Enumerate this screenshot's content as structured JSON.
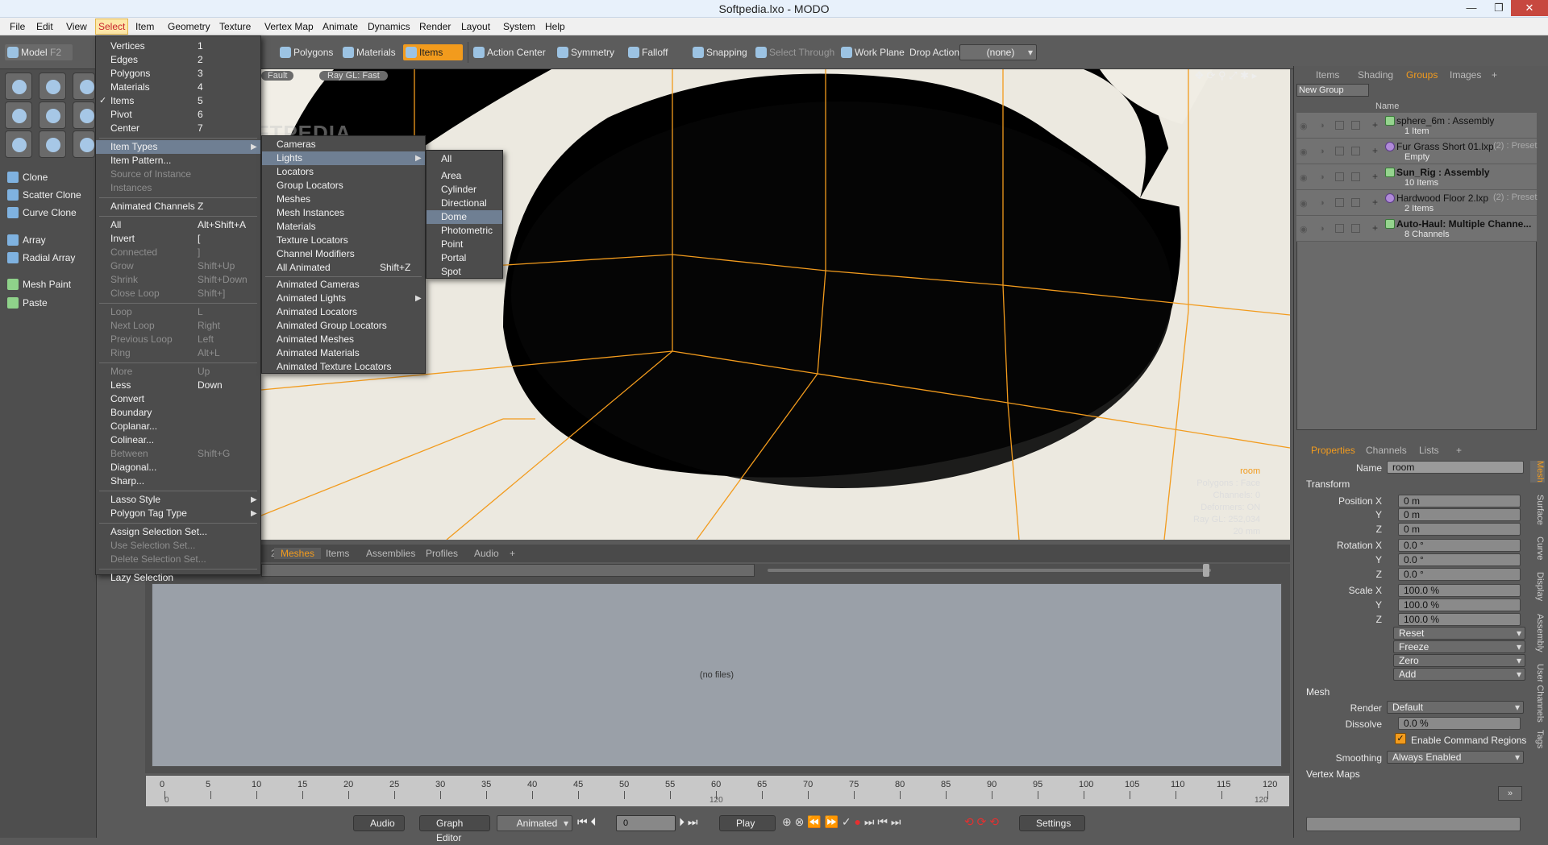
{
  "window": {
    "title": "Softpedia.lxo - MODO",
    "min": "—",
    "max": "❐",
    "close": "✕"
  },
  "menubar": [
    "File",
    "Edit",
    "View",
    "Select",
    "Item",
    "Geometry",
    "Texture",
    "Vertex Map",
    "Animate",
    "Dynamics",
    "Render",
    "Layout",
    "System",
    "Help"
  ],
  "toolbar": {
    "model": "Model",
    "model_key": "F2",
    "polygons": "Polygons",
    "materials": "Materials",
    "items": "Items",
    "action_center": "Action Center",
    "symmetry": "Symmetry",
    "falloff": "Falloff",
    "snapping": "Snapping",
    "select_through": "Select Through",
    "work_plane": "Work Plane",
    "drop_action": "Drop Action",
    "drop_value": "(none)"
  },
  "leftpanel": [
    "Clone",
    "Scatter Clone",
    "Curve Clone",
    "Array",
    "Radial Array",
    "Mesh Paint",
    "Paste"
  ],
  "select_menu": {
    "items": [
      {
        "label": "Vertices",
        "sc": "1"
      },
      {
        "label": "Edges",
        "sc": "2"
      },
      {
        "label": "Polygons",
        "sc": "3"
      },
      {
        "label": "Materials",
        "sc": "4"
      },
      {
        "label": "Items",
        "sc": "5"
      },
      {
        "label": "Pivot",
        "sc": "6"
      },
      {
        "label": "Center",
        "sc": "7"
      },
      {
        "label": "Item Types",
        "sc": ""
      },
      {
        "label": "Item Pattern...",
        "sc": ""
      },
      {
        "label": "Source of Instance",
        "sc": ""
      },
      {
        "label": "Instances",
        "sc": ""
      },
      {
        "label": "Animated Channels",
        "sc": "Z"
      },
      {
        "label": "All",
        "sc": "Alt+Shift+A"
      },
      {
        "label": "Invert",
        "sc": "["
      },
      {
        "label": "Connected",
        "sc": "]"
      },
      {
        "label": "Grow",
        "sc": "Shift+Up"
      },
      {
        "label": "Shrink",
        "sc": "Shift+Down"
      },
      {
        "label": "Close Loop",
        "sc": "Shift+]"
      },
      {
        "label": "Loop",
        "sc": "L"
      },
      {
        "label": "Next Loop",
        "sc": "Right"
      },
      {
        "label": "Previous Loop",
        "sc": "Left"
      },
      {
        "label": "Ring",
        "sc": "Alt+L"
      },
      {
        "label": "More",
        "sc": "Up"
      },
      {
        "label": "Less",
        "sc": "Down"
      },
      {
        "label": "Convert",
        "sc": ""
      },
      {
        "label": "Boundary",
        "sc": ""
      },
      {
        "label": "Coplanar...",
        "sc": ""
      },
      {
        "label": "Colinear...",
        "sc": ""
      },
      {
        "label": "Between",
        "sc": "Shift+G"
      },
      {
        "label": "Diagonal...",
        "sc": ""
      },
      {
        "label": "Sharp...",
        "sc": ""
      },
      {
        "label": "Lasso Style",
        "sc": ""
      },
      {
        "label": "Polygon Tag Type",
        "sc": ""
      },
      {
        "label": "Assign Selection Set...",
        "sc": ""
      },
      {
        "label": "Use Selection Set...",
        "sc": ""
      },
      {
        "label": "Delete Selection Set...",
        "sc": ""
      },
      {
        "label": "Lazy Selection",
        "sc": ""
      }
    ]
  },
  "item_types_menu": [
    "Cameras",
    "Lights",
    "Locators",
    "Group Locators",
    "Meshes",
    "Mesh Instances",
    "Materials",
    "Texture Locators",
    "Channel Modifiers",
    "All Animated",
    "Animated Cameras",
    "Animated Lights",
    "Animated Locators",
    "Animated Group Locators",
    "Animated Meshes",
    "Animated Materials",
    "Animated Texture Locators"
  ],
  "all_animated_sc": "Shift+Z",
  "lights_menu": [
    "All",
    "Area",
    "Cylinder",
    "Directional",
    "Dome",
    "Photometric",
    "Point",
    "Portal",
    "Spot"
  ],
  "viewport": {
    "tag1": "Fault",
    "tag2": "Ray GL: Fast",
    "watermark": "SOFTPEDIA",
    "info": [
      "room",
      "Polygons : Face",
      "Channels: 0",
      "Deformers: ON",
      "Ray GL: 252,034",
      "20 mm"
    ]
  },
  "bottom": {
    "tabs": [
      "Meshes",
      "Items",
      "Assemblies",
      "Profiles",
      "Audio",
      "+"
    ],
    "left_tab": "2",
    "empty": "(no files)"
  },
  "timeline": {
    "ticks": [
      "0",
      "5",
      "10",
      "15",
      "20",
      "25",
      "30",
      "35",
      "40",
      "45",
      "50",
      "55",
      "60",
      "65",
      "70",
      "75",
      "80",
      "85",
      "90",
      "95",
      "100",
      "105",
      "110",
      "115",
      "120"
    ],
    "start": "0",
    "mid": "120",
    "end": "120"
  },
  "transport": {
    "audio": "Audio",
    "graph": "Graph Editor",
    "animated": "Animated",
    "frame": "0",
    "play": "Play",
    "settings": "Settings"
  },
  "right": {
    "tabs": [
      "Items",
      "Shading",
      "Groups",
      "Images",
      "+"
    ],
    "new_group": "New Group",
    "name_col": "Name",
    "groups": [
      {
        "name": "sphere_6m : Assembly",
        "sub": "1 Item",
        "type": "asm"
      },
      {
        "name": "Fur Grass Short 01.lxp",
        "tag": "(2) : Preset",
        "sub": "Empty",
        "type": "preset"
      },
      {
        "name": "Sun_Rig : Assembly",
        "sub": "10 Items",
        "type": "asm"
      },
      {
        "name": "Hardwood Floor 2.lxp",
        "tag": "(2) : Preset",
        "sub": "2 Items",
        "type": "preset"
      },
      {
        "name": "Auto-Haul: Multiple Channe...",
        "sub": "8 Channels",
        "type": "asm"
      }
    ],
    "prop_tabs": [
      "Properties",
      "Channels",
      "Lists",
      "+"
    ],
    "name_label": "Name",
    "name_value": "room",
    "transform": "Transform",
    "pos": [
      "Position X",
      "Y",
      "Z"
    ],
    "pos_vals": [
      "0 m",
      "0 m",
      "0 m"
    ],
    "rot": [
      "Rotation X",
      "Y",
      "Z"
    ],
    "rot_vals": [
      "0.0 °",
      "0.0 °",
      "0.0 °"
    ],
    "scale": [
      "Scale X",
      "Y",
      "Z"
    ],
    "scale_vals": [
      "100.0 %",
      "100.0 %",
      "100.0 %"
    ],
    "buttons": [
      "Reset",
      "Freeze",
      "Zero",
      "Add"
    ],
    "mesh": "Mesh",
    "render_label": "Render",
    "render_value": "Default",
    "dissolve_label": "Dissolve",
    "dissolve_value": "0.0 %",
    "ecr": "Enable Command Regions",
    "smoothing_label": "Smoothing",
    "smoothing_value": "Always Enabled",
    "vertex_maps": "Vertex Maps",
    "side_tabs": [
      "Mesh",
      "Surface",
      "Curve",
      "Display",
      "Assembly",
      "User Channels",
      "Tags"
    ]
  }
}
